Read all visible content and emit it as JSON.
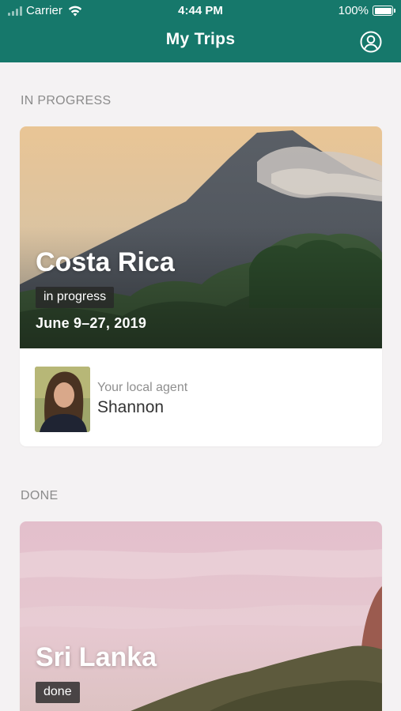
{
  "status_bar": {
    "carrier": "Carrier",
    "time": "4:44 PM",
    "battery": "100%"
  },
  "header": {
    "title": "My Trips",
    "profile_icon": "user-circle-icon"
  },
  "colors": {
    "header_bg": "#16786b",
    "page_bg": "#f4f2f3",
    "badge_bg": "#2b2b2b"
  },
  "sections": [
    {
      "heading": "IN PROGRESS",
      "trips": [
        {
          "name": "Costa Rica",
          "status": "in progress",
          "dates": "June 9–27, 2019",
          "agent_caption": "Your local agent",
          "agent_name": "Shannon"
        }
      ]
    },
    {
      "heading": "DONE",
      "trips": [
        {
          "name": "Sri Lanka",
          "status": "done"
        }
      ]
    }
  ]
}
